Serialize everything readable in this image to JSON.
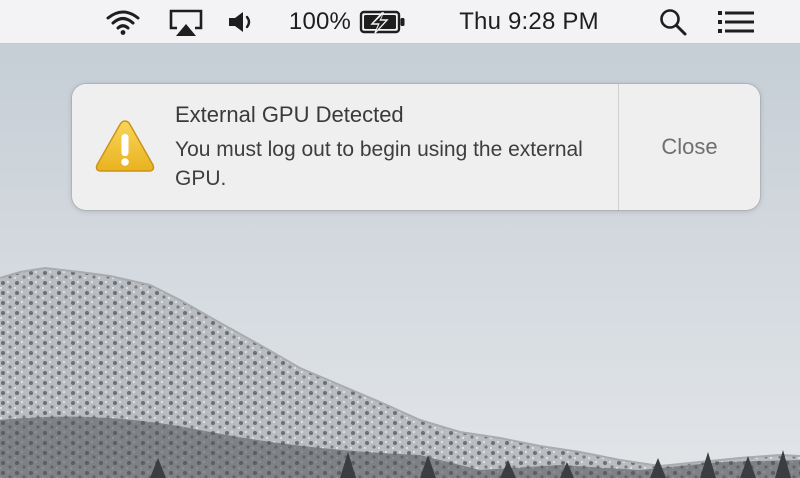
{
  "menubar": {
    "icons": [
      "wifi-icon",
      "airplay-icon",
      "volume-icon"
    ],
    "battery_percent": "100%",
    "battery_state": "charging",
    "clock": "Thu 9:28 PM",
    "right_icons": [
      "spotlight-search-icon",
      "notification-center-icon"
    ]
  },
  "notification": {
    "icon": "warning-icon",
    "title": "External GPU Detected",
    "body": "You must log out to begin using the external GPU.",
    "close_label": "Close"
  },
  "colors": {
    "warning_yellow": "#f2c12e",
    "menubar_bg": "#f5f5f6",
    "notification_bg": "#f0f0f1"
  }
}
